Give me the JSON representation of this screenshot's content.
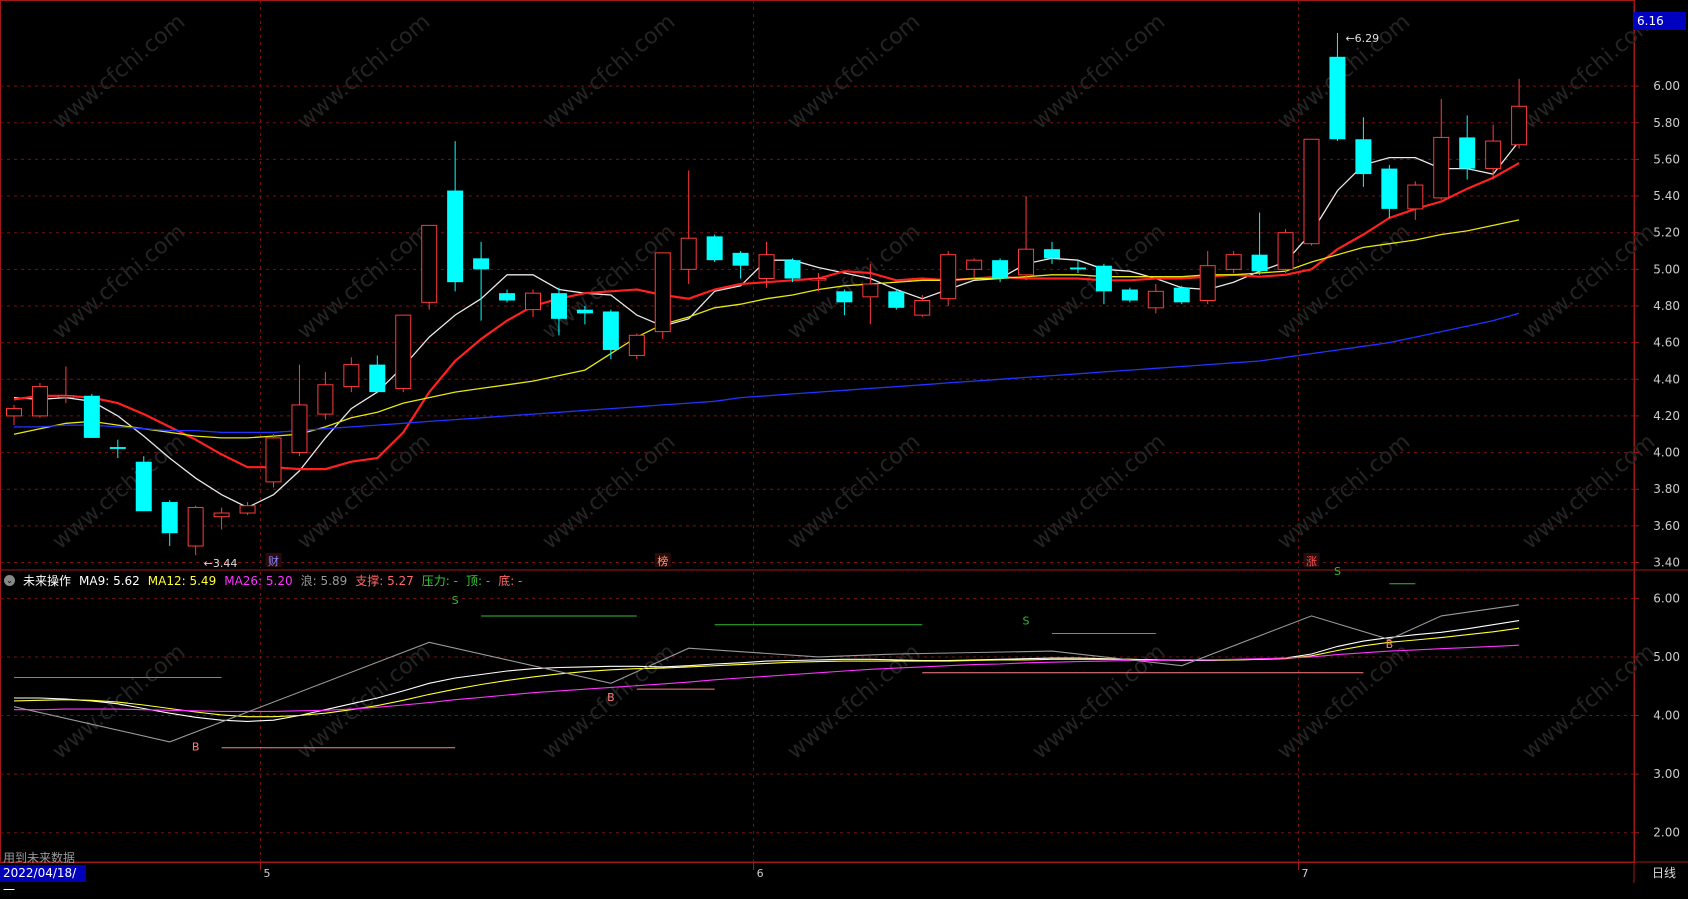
{
  "chart_data": {
    "type": "candlestick",
    "price_axis": {
      "ylim": [
        3.37,
        6.47
      ],
      "ticks": [
        "6.00",
        "5.80",
        "5.60",
        "5.40",
        "5.20",
        "5.00",
        "4.80",
        "4.60",
        "4.40",
        "4.20",
        "4.00",
        "3.80",
        "3.60",
        "3.40"
      ],
      "tick_values": [
        6.0,
        5.8,
        5.6,
        5.4,
        5.2,
        5.0,
        4.8,
        4.6,
        4.4,
        4.2,
        4.0,
        3.8,
        3.6,
        3.4
      ]
    },
    "indicator_axis": {
      "ylim": [
        1.5,
        6.45
      ],
      "ticks": [
        "6.00",
        "5.00",
        "4.00",
        "3.00",
        "2.00"
      ],
      "tick_values": [
        6,
        5,
        4,
        3,
        2
      ]
    },
    "x_axis_labels": [
      "2022/04/18/一",
      "5",
      "6",
      "7"
    ],
    "month_start_index": [
      0,
      10,
      29,
      50
    ],
    "candles": [
      {
        "o": 4.2,
        "c": 4.24,
        "h": 4.26,
        "l": 4.15
      },
      {
        "o": 4.2,
        "c": 4.36,
        "h": 4.38,
        "l": 4.19
      },
      {
        "o": 4.31,
        "c": 4.31,
        "h": 4.47,
        "l": 4.27
      },
      {
        "o": 4.31,
        "c": 4.08,
        "h": 4.32,
        "l": 4.08
      },
      {
        "o": 4.03,
        "c": 4.02,
        "h": 4.07,
        "l": 3.97
      },
      {
        "o": 3.95,
        "c": 3.68,
        "h": 3.98,
        "l": 3.68
      },
      {
        "o": 3.73,
        "c": 3.56,
        "h": 3.74,
        "l": 3.49
      },
      {
        "o": 3.49,
        "c": 3.7,
        "h": 3.71,
        "l": 3.44
      },
      {
        "o": 3.65,
        "c": 3.67,
        "h": 3.7,
        "l": 3.58
      },
      {
        "o": 3.67,
        "c": 3.71,
        "h": 3.73,
        "l": 3.66
      },
      {
        "o": 3.84,
        "c": 4.08,
        "h": 4.1,
        "l": 3.81
      },
      {
        "o": 4.0,
        "c": 4.26,
        "h": 4.48,
        "l": 3.98
      },
      {
        "o": 4.21,
        "c": 4.37,
        "h": 4.44,
        "l": 4.18
      },
      {
        "o": 4.36,
        "c": 4.48,
        "h": 4.52,
        "l": 4.33
      },
      {
        "o": 4.48,
        "c": 4.33,
        "h": 4.53,
        "l": 4.33
      },
      {
        "o": 4.35,
        "c": 4.75,
        "h": 4.75,
        "l": 4.33
      },
      {
        "o": 4.82,
        "c": 5.24,
        "h": 5.24,
        "l": 4.78
      },
      {
        "o": 5.43,
        "c": 4.93,
        "h": 5.7,
        "l": 4.88
      },
      {
        "o": 5.06,
        "c": 5.0,
        "h": 5.15,
        "l": 4.72
      },
      {
        "o": 4.87,
        "c": 4.83,
        "h": 4.89,
        "l": 4.82
      },
      {
        "o": 4.78,
        "c": 4.87,
        "h": 4.89,
        "l": 4.74
      },
      {
        "o": 4.87,
        "c": 4.73,
        "h": 4.9,
        "l": 4.64
      },
      {
        "o": 4.78,
        "c": 4.76,
        "h": 4.8,
        "l": 4.7
      },
      {
        "o": 4.77,
        "c": 4.56,
        "h": 4.78,
        "l": 4.51
      },
      {
        "o": 4.53,
        "c": 4.64,
        "h": 4.65,
        "l": 4.51
      },
      {
        "o": 4.66,
        "c": 5.09,
        "h": 5.09,
        "l": 4.62
      },
      {
        "o": 5.0,
        "c": 5.17,
        "h": 5.54,
        "l": 4.92
      },
      {
        "o": 5.18,
        "c": 5.05,
        "h": 5.19,
        "l": 5.04
      },
      {
        "o": 5.09,
        "c": 5.02,
        "h": 5.1,
        "l": 4.95
      },
      {
        "o": 4.95,
        "c": 5.08,
        "h": 5.15,
        "l": 4.9
      },
      {
        "o": 5.05,
        "c": 4.95,
        "h": 5.06,
        "l": 4.93
      },
      {
        "o": 4.95,
        "c": 4.95,
        "h": 4.98,
        "l": 4.88
      },
      {
        "o": 4.88,
        "c": 4.82,
        "h": 4.89,
        "l": 4.75
      },
      {
        "o": 4.85,
        "c": 4.92,
        "h": 5.03,
        "l": 4.7
      },
      {
        "o": 4.88,
        "c": 4.79,
        "h": 4.89,
        "l": 4.78
      },
      {
        "o": 4.75,
        "c": 4.83,
        "h": 4.86,
        "l": 4.74
      },
      {
        "o": 4.84,
        "c": 5.08,
        "h": 5.1,
        "l": 4.8
      },
      {
        "o": 5.0,
        "c": 5.05,
        "h": 5.06,
        "l": 4.95
      },
      {
        "o": 5.05,
        "c": 4.95,
        "h": 5.06,
        "l": 4.93
      },
      {
        "o": 4.97,
        "c": 5.11,
        "h": 5.4,
        "l": 4.94
      },
      {
        "o": 5.11,
        "c": 5.06,
        "h": 5.15,
        "l": 5.03
      },
      {
        "o": 5.01,
        "c": 5.0,
        "h": 5.05,
        "l": 4.98
      },
      {
        "o": 5.02,
        "c": 4.88,
        "h": 5.03,
        "l": 4.81
      },
      {
        "o": 4.89,
        "c": 4.83,
        "h": 4.9,
        "l": 4.82
      },
      {
        "o": 4.79,
        "c": 4.88,
        "h": 4.92,
        "l": 4.76
      },
      {
        "o": 4.9,
        "c": 4.82,
        "h": 4.91,
        "l": 4.81
      },
      {
        "o": 4.83,
        "c": 5.02,
        "h": 5.1,
        "l": 4.81
      },
      {
        "o": 5.0,
        "c": 5.08,
        "h": 5.1,
        "l": 4.98
      },
      {
        "o": 5.08,
        "c": 4.99,
        "h": 5.31,
        "l": 4.97
      },
      {
        "o": 5.0,
        "c": 5.2,
        "h": 5.22,
        "l": 4.98
      },
      {
        "o": 5.14,
        "c": 5.71,
        "h": 5.71,
        "l": 5.13
      },
      {
        "o": 6.16,
        "c": 5.71,
        "h": 6.29,
        "l": 5.7
      },
      {
        "o": 5.71,
        "c": 5.52,
        "h": 5.83,
        "l": 5.45
      },
      {
        "o": 5.55,
        "c": 5.33,
        "h": 5.57,
        "l": 5.28
      },
      {
        "o": 5.33,
        "c": 5.46,
        "h": 5.48,
        "l": 5.27
      },
      {
        "o": 5.39,
        "c": 5.72,
        "h": 5.93,
        "l": 5.38
      },
      {
        "o": 5.72,
        "c": 5.55,
        "h": 5.84,
        "l": 5.49
      },
      {
        "o": 5.55,
        "c": 5.7,
        "h": 5.79,
        "l": 5.49
      },
      {
        "o": 5.68,
        "c": 5.89,
        "h": 6.04,
        "l": 5.66
      }
    ],
    "ma_lines": [
      {
        "name": "MA5",
        "color": "#e8e8e8",
        "values": [
          4.3,
          4.29,
          4.3,
          4.28,
          4.2,
          4.09,
          3.97,
          3.86,
          3.77,
          3.7,
          3.77,
          3.9,
          4.08,
          4.24,
          4.33,
          4.47,
          4.63,
          4.75,
          4.84,
          4.97,
          4.97,
          4.89,
          4.87,
          4.86,
          4.75,
          4.69,
          4.73,
          4.88,
          4.91,
          5.05,
          5.05,
          5.01,
          4.98,
          4.95,
          4.89,
          4.84,
          4.89,
          4.94,
          4.95,
          5.03,
          5.06,
          5.05,
          5.0,
          4.99,
          4.95,
          4.9,
          4.89,
          4.93,
          4.99,
          5.04,
          5.2,
          5.43,
          5.57,
          5.61,
          5.61,
          5.55,
          5.55,
          5.52,
          5.7
        ]
      },
      {
        "name": "MA10",
        "color": "#ff2020",
        "values": [
          4.29,
          4.31,
          4.31,
          4.3,
          4.27,
          4.21,
          4.14,
          4.07,
          3.99,
          3.92,
          3.92,
          3.91,
          3.91,
          3.95,
          3.97,
          4.11,
          4.33,
          4.5,
          4.62,
          4.72,
          4.8,
          4.84,
          4.87,
          4.88,
          4.89,
          4.86,
          4.84,
          4.89,
          4.92,
          4.93,
          4.94,
          4.95,
          4.99,
          4.98,
          4.94,
          4.95,
          4.94,
          4.95,
          4.96,
          4.95,
          4.95,
          4.95,
          4.94,
          4.94,
          4.95,
          4.95,
          4.96,
          4.97,
          4.96,
          4.97,
          5.0,
          5.11,
          5.19,
          5.28,
          5.33,
          5.37,
          5.44,
          5.5,
          5.58
        ]
      },
      {
        "name": "MA20",
        "color": "#e6e610",
        "values": [
          4.1,
          4.13,
          4.16,
          4.17,
          4.15,
          4.13,
          4.11,
          4.09,
          4.08,
          4.08,
          4.09,
          4.1,
          4.14,
          4.19,
          4.22,
          4.27,
          4.3,
          4.33,
          4.35,
          4.37,
          4.39,
          4.42,
          4.45,
          4.54,
          4.63,
          4.7,
          4.74,
          4.79,
          4.81,
          4.84,
          4.86,
          4.89,
          4.91,
          4.92,
          4.93,
          4.94,
          4.94,
          4.95,
          4.95,
          4.96,
          4.97,
          4.97,
          4.96,
          4.96,
          4.96,
          4.96,
          4.97,
          4.97,
          4.98,
          4.99,
          5.04,
          5.08,
          5.12,
          5.14,
          5.16,
          5.19,
          5.21,
          5.24,
          5.27
        ]
      },
      {
        "name": "MA60",
        "color": "#2233ff",
        "values": [
          4.14,
          4.14,
          4.15,
          4.15,
          4.14,
          4.13,
          4.12,
          4.12,
          4.11,
          4.11,
          4.11,
          4.12,
          4.13,
          4.14,
          4.15,
          4.16,
          4.17,
          4.18,
          4.19,
          4.2,
          4.21,
          4.22,
          4.23,
          4.24,
          4.25,
          4.26,
          4.27,
          4.28,
          4.3,
          4.31,
          4.32,
          4.33,
          4.34,
          4.35,
          4.36,
          4.37,
          4.38,
          4.39,
          4.4,
          4.41,
          4.42,
          4.43,
          4.44,
          4.45,
          4.46,
          4.47,
          4.48,
          4.49,
          4.5,
          4.52,
          4.54,
          4.56,
          4.58,
          4.6,
          4.63,
          4.66,
          4.69,
          4.72,
          4.76
        ]
      }
    ],
    "annotations": {
      "low": {
        "label": "3.44",
        "index": 7,
        "value": 3.44
      },
      "high": {
        "label": "6.29",
        "index": 51,
        "value": 6.29
      },
      "markers": [
        {
          "label": "财",
          "index": 10,
          "color": "#8888ff"
        },
        {
          "label": "榜",
          "index": 25,
          "color": "#ff9966"
        },
        {
          "label": "涨",
          "index": 50,
          "color": "#ff5555"
        }
      ]
    },
    "indicator": {
      "name": "未来操作",
      "legend": [
        {
          "label": "MA9:",
          "value": "5.62",
          "color": "#ffffff"
        },
        {
          "label": "MA12:",
          "value": "5.49",
          "color": "#ffff33"
        },
        {
          "label": "MA26:",
          "value": "5.20",
          "color": "#ff33ff"
        },
        {
          "label": "浪:",
          "value": "5.89",
          "color": "#999999"
        },
        {
          "label": "支撑:",
          "value": "5.27",
          "color": "#ff6666"
        },
        {
          "label": "压力:",
          "value": "-",
          "color": "#33cc33"
        },
        {
          "label": "顶:",
          "value": "-",
          "color": "#33cc33"
        },
        {
          "label": "底:",
          "value": "-",
          "color": "#ff6666"
        }
      ],
      "lines": [
        {
          "name": "MA9",
          "color": "#ffffff",
          "values": [
            4.3,
            4.3,
            4.28,
            4.25,
            4.2,
            4.12,
            4.04,
            3.97,
            3.92,
            3.9,
            3.92,
            4.0,
            4.1,
            4.2,
            4.3,
            4.42,
            4.55,
            4.64,
            4.7,
            4.76,
            4.8,
            4.82,
            4.83,
            4.84,
            4.84,
            4.83,
            4.85,
            4.88,
            4.9,
            4.93,
            4.94,
            4.95,
            4.96,
            4.96,
            4.95,
            4.94,
            4.94,
            4.95,
            4.96,
            4.97,
            4.98,
            4.98,
            4.97,
            4.96,
            4.95,
            4.94,
            4.94,
            4.95,
            4.96,
            4.98,
            5.05,
            5.18,
            5.27,
            5.33,
            5.38,
            5.42,
            5.48,
            5.55,
            5.62
          ]
        },
        {
          "name": "MA12",
          "color": "#ffff33",
          "values": [
            4.25,
            4.26,
            4.27,
            4.26,
            4.23,
            4.18,
            4.12,
            4.06,
            4.01,
            3.98,
            3.98,
            4.0,
            4.04,
            4.1,
            4.17,
            4.26,
            4.36,
            4.45,
            4.53,
            4.6,
            4.66,
            4.71,
            4.75,
            4.78,
            4.8,
            4.81,
            4.83,
            4.85,
            4.87,
            4.89,
            4.91,
            4.92,
            4.93,
            4.93,
            4.93,
            4.93,
            4.93,
            4.94,
            4.95,
            4.95,
            4.96,
            4.96,
            4.96,
            4.96,
            4.95,
            4.95,
            4.95,
            4.95,
            4.96,
            4.97,
            5.02,
            5.11,
            5.19,
            5.25,
            5.29,
            5.33,
            5.38,
            5.43,
            5.49
          ]
        },
        {
          "name": "MA26",
          "color": "#ff33ff",
          "values": [
            4.1,
            4.1,
            4.11,
            4.11,
            4.11,
            4.1,
            4.09,
            4.08,
            4.07,
            4.07,
            4.07,
            4.08,
            4.09,
            4.11,
            4.14,
            4.18,
            4.22,
            4.27,
            4.31,
            4.35,
            4.39,
            4.42,
            4.45,
            4.48,
            4.51,
            4.54,
            4.57,
            4.61,
            4.64,
            4.67,
            4.7,
            4.73,
            4.76,
            4.79,
            4.81,
            4.83,
            4.85,
            4.87,
            4.88,
            4.9,
            4.91,
            4.92,
            4.93,
            4.94,
            4.94,
            4.95,
            4.95,
            4.96,
            4.97,
            4.98,
            5.0,
            5.04,
            5.07,
            5.1,
            5.12,
            5.14,
            5.16,
            5.18,
            5.2
          ]
        },
        {
          "name": "浪",
          "color": "#999999",
          "points": [
            [
              0,
              4.15
            ],
            [
              6,
              3.55
            ],
            [
              16,
              5.25
            ],
            [
              23,
              4.55
            ],
            [
              26,
              5.15
            ],
            [
              31,
              5.0
            ],
            [
              34,
              5.05
            ],
            [
              40,
              5.1
            ],
            [
              45,
              4.85
            ],
            [
              50,
              5.7
            ],
            [
              53,
              5.3
            ],
            [
              55,
              5.7
            ],
            [
              58,
              5.89
            ]
          ]
        }
      ],
      "segments": [
        {
          "color": "#33bb33",
          "from": 0,
          "to": 8,
          "value": 4.65
        },
        {
          "color": "#ff8080",
          "from": 8,
          "to": 17,
          "value": 3.45
        },
        {
          "color": "#33bb33",
          "from": 18,
          "to": 24,
          "value": 5.7
        },
        {
          "color": "#ff8080",
          "from": 24,
          "to": 27,
          "value": 4.45
        },
        {
          "color": "#33bb33",
          "from": 27,
          "to": 35,
          "value": 5.55
        },
        {
          "color": "#ff8080",
          "from": 35,
          "to": 52,
          "value": 4.73
        },
        {
          "color": "#33bb33",
          "from": 40,
          "to": 44,
          "value": 5.4
        },
        {
          "color": "#33bb33",
          "from": 53,
          "to": 54,
          "value": 6.25
        }
      ],
      "letters": [
        {
          "text": "S",
          "index": 17,
          "value": 5.9,
          "color": "#33bb33"
        },
        {
          "text": "B",
          "index": 7,
          "value": 3.4,
          "color": "#ff8080"
        },
        {
          "text": "B",
          "index": 23,
          "value": 4.25,
          "color": "#ff8080"
        },
        {
          "text": "S",
          "index": 39,
          "value": 5.55,
          "color": "#33bb33"
        },
        {
          "text": "B",
          "index": 53,
          "value": 5.15,
          "color": "#ff8080"
        },
        {
          "text": "S",
          "index": 51,
          "value": 6.4,
          "color": "#33bb33"
        }
      ]
    },
    "current_price": "6.16"
  },
  "ui": {
    "footer_note": "用到未来数据",
    "date_label": "2022/04/18/一",
    "period": "日线",
    "price_tag": "6.16"
  },
  "colors": {
    "up": "#ff3b3b",
    "down": "#00ffff",
    "grid": "#7a1010",
    "axis": "#a01818",
    "watermark": "#242424"
  }
}
